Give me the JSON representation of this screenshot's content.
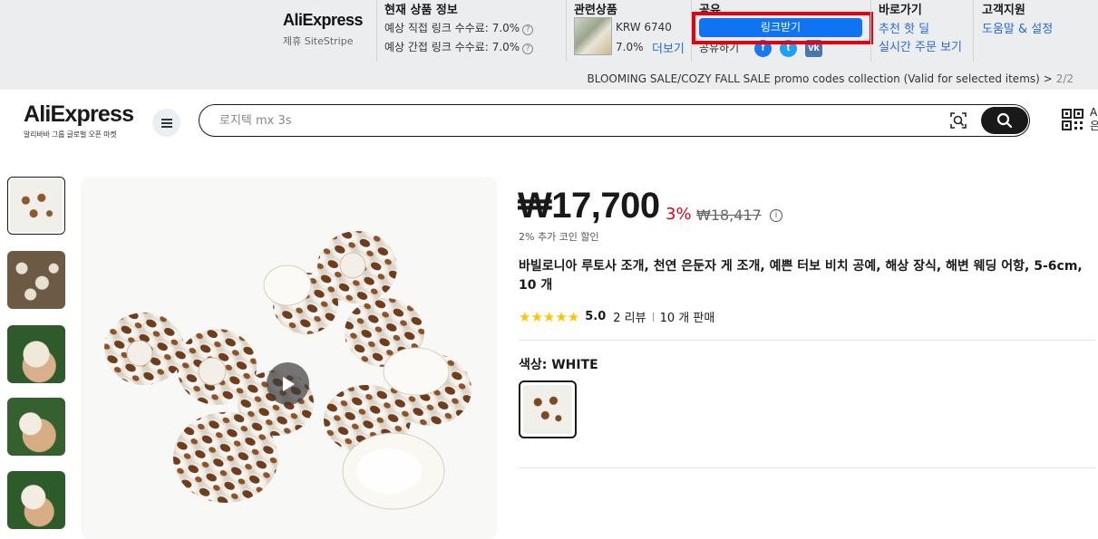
{
  "sitestripe": {
    "logo": "AliExpress",
    "logo_sub": "제휴 SiteStripe",
    "current_info": {
      "title": "현재 상품 정보",
      "direct_label": "예상 직접 링크 수수료:",
      "direct_value": "7.0%",
      "indirect_label": "예상 간접 링크 수수료:",
      "indirect_value": "7.0%"
    },
    "related": {
      "title": "관련상품",
      "price": "KRW 6740",
      "rate": "7.0%",
      "more": "더보기"
    },
    "share": {
      "title": "공유",
      "get_link": "링크받기",
      "share_label": "공유하기",
      "facebook_icon": "facebook-icon",
      "twitter_icon": "twitter-icon",
      "vk_icon": "vk-icon"
    },
    "shortcut": {
      "title": "바로가기",
      "hot_deals": "추천 핫 딜",
      "live_orders": "실시간 주문 보기"
    },
    "support": {
      "title": "고객지원",
      "help": "도움말 & 설정"
    },
    "promo": "BLOOMING SALE/COZY FALL SALE promo codes collection (Valid for selected items) >",
    "promo_page": "2/2"
  },
  "header": {
    "logo": "AliExpress",
    "tagline": "알리바바 그룹 글로벌 오픈 마켓",
    "search_placeholder": "로지텍 mx 3s",
    "cut_text_1": "A",
    "cut_text_2": "은"
  },
  "product": {
    "price": "₩17,700",
    "discount": "3%",
    "original_price": "₩18,417",
    "coin_discount": "2% 추가 코인 할인",
    "title": "바빌로니아 루토사 조개, 천연 은둔자 게 조개, 예쁜 터보 비치 공예, 해상 장식, 해변 웨딩 어항, 5-6cm, 10 개",
    "stars": "★★★★★",
    "rating": "5.0",
    "reviews": "2 리뷰",
    "sold": "10 개 판매",
    "color_label": "색상: WHITE"
  },
  "colors": {
    "accent_blue": "#0e74f4",
    "highlight_red": "#e6000f",
    "price_red": "#d3031c",
    "star_yellow": "#fdc300"
  }
}
